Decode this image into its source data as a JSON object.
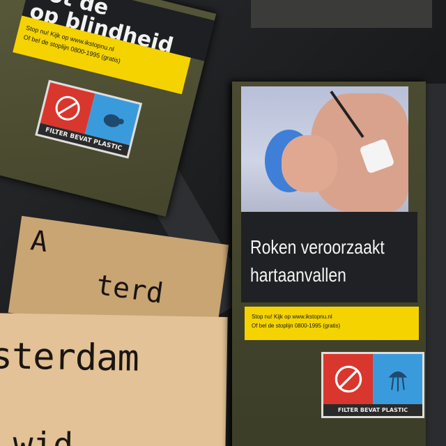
{
  "pack_top_left": {
    "warning_partial": "oot de\nop blindheid",
    "quit_line_1": "Stop nu! Kijk op www.ikstopnu.nl",
    "quit_line_2": "Of bel de stoplijn 0800-1995 (gratis)",
    "logo_label": "FILTER BEVAT PLASTIC"
  },
  "pack_right": {
    "warning_line_1": "Roken veroorzaakt",
    "warning_line_2": "hartaanvallen",
    "quit_line_1": "Stop nu! Kijk op www.ikstopnu.nl",
    "quit_line_2": "Of bel de stoplijn 0800-1995 (gratis)",
    "logo_label": "FILTER BEVAT PLASTIC"
  },
  "sign": {
    "main_text": "sterdam",
    "back_text_1": "A",
    "back_text_2": "terd",
    "bottom_partial": "wid"
  },
  "colors": {
    "warning_yellow": "#f4d300",
    "logo_red": "#d9362e",
    "logo_blue": "#3a9bdc",
    "pack_olive": "#4a4b30",
    "cardboard": "#e2c296"
  }
}
